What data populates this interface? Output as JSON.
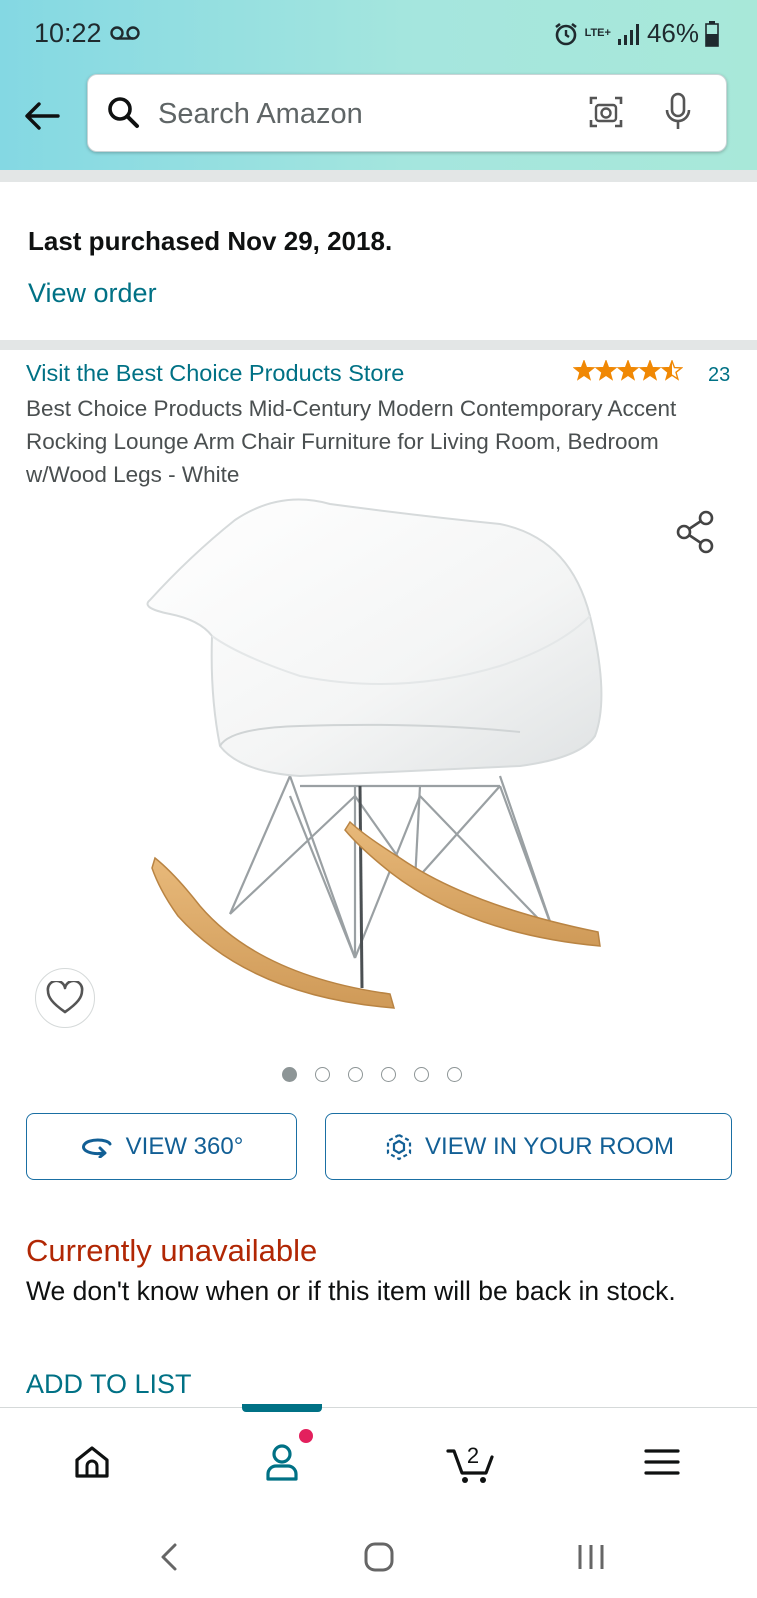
{
  "status_bar": {
    "time": "10:22",
    "network_label": "LTE+",
    "battery_percent": "46%"
  },
  "search": {
    "placeholder": "Search Amazon"
  },
  "purchase_info": {
    "last_purchased": "Last purchased Nov 29, 2018.",
    "view_order": "View order"
  },
  "product": {
    "store_link": "Visit the Best Choice Products Store",
    "rating_stars": 4.5,
    "rating_count": "23",
    "title": "Best Choice Products Mid-Century Modern Contemporary Accent Rocking Lounge Arm Chair Furniture for Living Room, Bedroom w/Wood Legs - White",
    "image_count": 6,
    "active_image_index": 0
  },
  "buttons": {
    "view_360": "VIEW 360°",
    "view_in_room": "VIEW IN YOUR ROOM"
  },
  "availability": {
    "status": "Currently unavailable",
    "note": "We don't know when or if this item will be back in stock."
  },
  "add_to_list": "ADD TO LIST",
  "bottom_nav": {
    "cart_count": "2",
    "active_tab": "account"
  },
  "colors": {
    "link": "#007185",
    "unavailable": "#b12704",
    "star": "#f08804",
    "button_outline": "#1a6fa3",
    "notification_dot": "#e3205d"
  }
}
